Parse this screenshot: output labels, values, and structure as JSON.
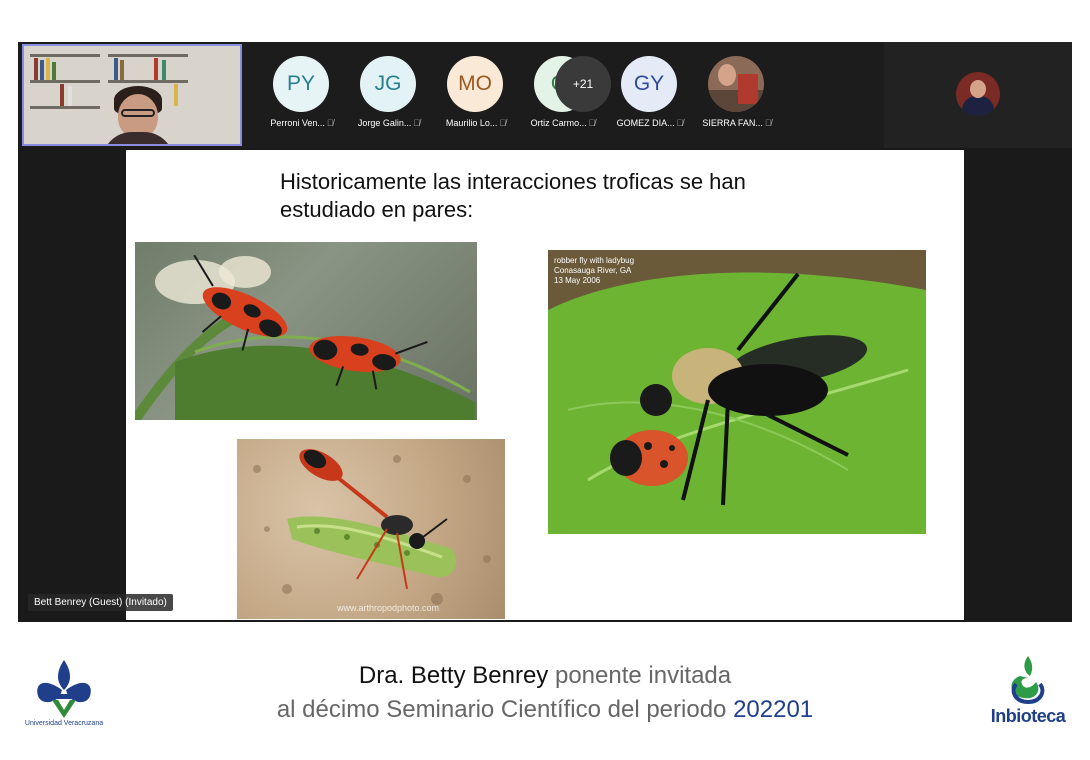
{
  "participants": [
    {
      "initials": "PY",
      "name": "Perroni Ven...",
      "avatar_bg": "#e6f4f6",
      "avatar_fg": "#2a7f8f"
    },
    {
      "initials": "JG",
      "name": "Jorge Galin...",
      "avatar_bg": "#e3f3f5",
      "avatar_fg": "#2a7f8f"
    },
    {
      "initials": "MO",
      "name": "Maurilio Lo...",
      "avatar_bg": "#fbe9d7",
      "avatar_fg": "#9a5a1f"
    },
    {
      "initials": "OI",
      "name": "Ortiz Carmo...",
      "avatar_bg": "#e4f3e8",
      "avatar_fg": "#2f7a45"
    },
    {
      "initials": "GY",
      "name": "GOMEZ DIA...",
      "avatar_bg": "#e5eaf7",
      "avatar_fg": "#2e4a9a"
    },
    {
      "initials": "",
      "name": "SIERRA FAN...",
      "avatar_bg": "#8b6a58",
      "avatar_fg": "#ffffff"
    }
  ],
  "more_count": "+21",
  "mute_glyph": "🎙̸",
  "slide": {
    "title": "Historicamente las interacciones troficas se han estudiado en pares:",
    "fly_caption_line1": "robber fly with ladybug",
    "fly_caption_line2": "Conasauga River, GA",
    "fly_caption_line3": "13 May 2006",
    "wasp_watermark": "www.arthropodphoto.com"
  },
  "presenter_badge": "Bett Benrey (Guest) (Invitado)",
  "footer": {
    "line1_name": "Dra. Betty Benrey",
    "line1_rest": " ponente invitada",
    "line2_prefix": "al décimo Seminario Científico del periodo ",
    "line2_period": "202201",
    "uv_label": "Universidad Veracruzana",
    "inbioteca_label": "Inbioteca"
  },
  "colors": {
    "brand_blue": "#1f3f8a",
    "meeting_bg": "#1a1a1a",
    "self_tile_border": "#8a8de0"
  }
}
